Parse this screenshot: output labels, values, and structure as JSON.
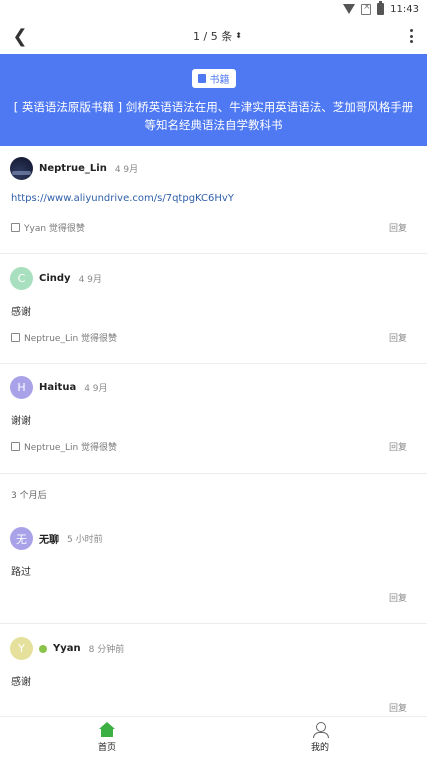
{
  "status_bar": {
    "time": "11:43",
    "icons": [
      "wifi-icon",
      "no-sim-icon",
      "battery-icon"
    ]
  },
  "top_nav": {
    "pager": "1 / 5 条",
    "icons": [
      "back-arrow-icon",
      "sort-updown-icon",
      "more-vertical-icon"
    ]
  },
  "hero": {
    "tag_label": "书籍",
    "title": "[ 英语语法原版书籍 ] 剑桥英语语法在用、牛津实用英语语法、芝加哥风格手册等知名经典语法自学教科书",
    "colors": {
      "background": "#4f79f3",
      "text": "#ffffff"
    }
  },
  "posts": [
    {
      "username": "Neptrue_Lin",
      "time": "4 9月",
      "body": "https://www.aliyundrive.com/s/7qtpgKC6HvY",
      "like_text": "Yyan 觉得很赞",
      "reply_label": "回复"
    },
    {
      "avatar_letter": "C",
      "username": "Cindy",
      "time": "4 9月",
      "body": "感谢",
      "like_text": "Neptrue_Lin 觉得很赞",
      "reply_label": "回复"
    },
    {
      "avatar_letter": "H",
      "username": "Haitua",
      "time": "4 9月",
      "body": "谢谢",
      "like_text": "Neptrue_Lin 觉得很赞",
      "reply_label": "回复"
    },
    {
      "avatar_letter": "无",
      "username": "无聊",
      "time": "5 小时前",
      "body": "路过",
      "reply_label": "回复"
    },
    {
      "avatar_letter": "Y",
      "username": "Yyan",
      "time": "8 分钟前",
      "body": "感谢",
      "reply_label": "回复"
    }
  ],
  "time_divider": "3 个月后",
  "avatar_colors": {
    "Cindy": "#a8dfbf",
    "Haitua": "#a9a2e8",
    "无聊": "#a9a2e8",
    "Yyan": "#e5e09c"
  },
  "tabs": [
    {
      "label": "首页",
      "icon": "home-icon",
      "active": true
    },
    {
      "label": "我的",
      "icon": "user-icon",
      "active": false
    }
  ],
  "colors": {
    "accent_green": "#3cb043",
    "link": "#2f5fa8"
  }
}
